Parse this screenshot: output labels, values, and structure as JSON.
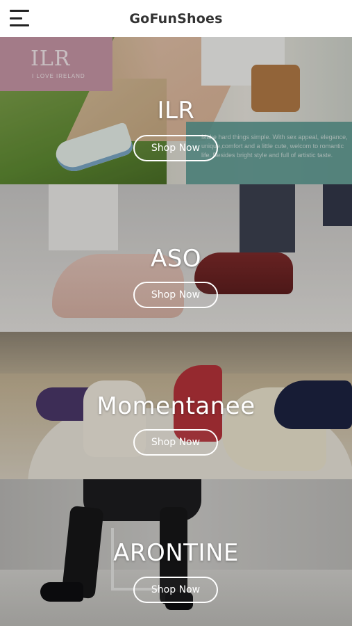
{
  "header": {
    "title": "GoFunShoes",
    "menu_icon": "hamburger-menu-icon"
  },
  "banners": [
    {
      "brand": "ILR",
      "button_label": "Shop Now",
      "logo_text": "ILR",
      "logo_subtext": "I LOVE IRELAND",
      "tagline": "Make hard things simple. With sex appeal, elegance, unique,comfort and a little cute, welcom to romantic life. Besides bright style and full of artistic taste."
    },
    {
      "brand": "ASO",
      "button_label": "Shop Now"
    },
    {
      "brand": "Momentanee",
      "button_label": "Shop Now"
    },
    {
      "brand": "ARONTINE",
      "button_label": "Shop Now"
    }
  ],
  "colors": {
    "header_bg": "#ffffff",
    "title_text": "#333333",
    "button_border": "#ffffff",
    "logo_box": "#c797a6",
    "teal_box": "#5d9a93"
  }
}
